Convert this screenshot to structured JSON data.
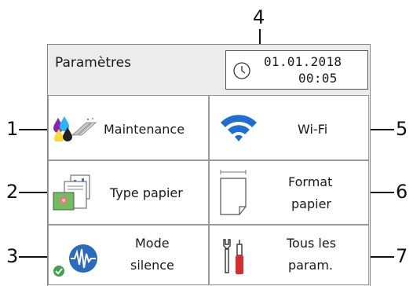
{
  "callouts": [
    "1",
    "2",
    "3",
    "4",
    "5",
    "6",
    "7"
  ],
  "header": {
    "title": "Paramètres",
    "date": "01.01.2018",
    "time": "00:05",
    "clock_icon": "clock-icon"
  },
  "tiles": {
    "maintenance": {
      "label": "Maintenance",
      "icon": "ink-drops-icon"
    },
    "wifi": {
      "label": "Wi-Fi",
      "icon": "wifi-icon",
      "color": "#1f6fd0"
    },
    "paper_type": {
      "label": "Type papier",
      "icon": "paper-type-icon"
    },
    "paper_size": {
      "line1": "Format",
      "line2": "papier",
      "icon": "paper-size-icon"
    },
    "quiet_mode": {
      "line1": "Mode",
      "line2": "silence",
      "icon": "quiet-mode-icon",
      "color": "#2a6bc0",
      "badge_color": "#3ea34a"
    },
    "all_settings": {
      "line1": "Tous les",
      "line2": "param.",
      "icon": "tools-icon",
      "accent": "#d32f2f"
    }
  }
}
